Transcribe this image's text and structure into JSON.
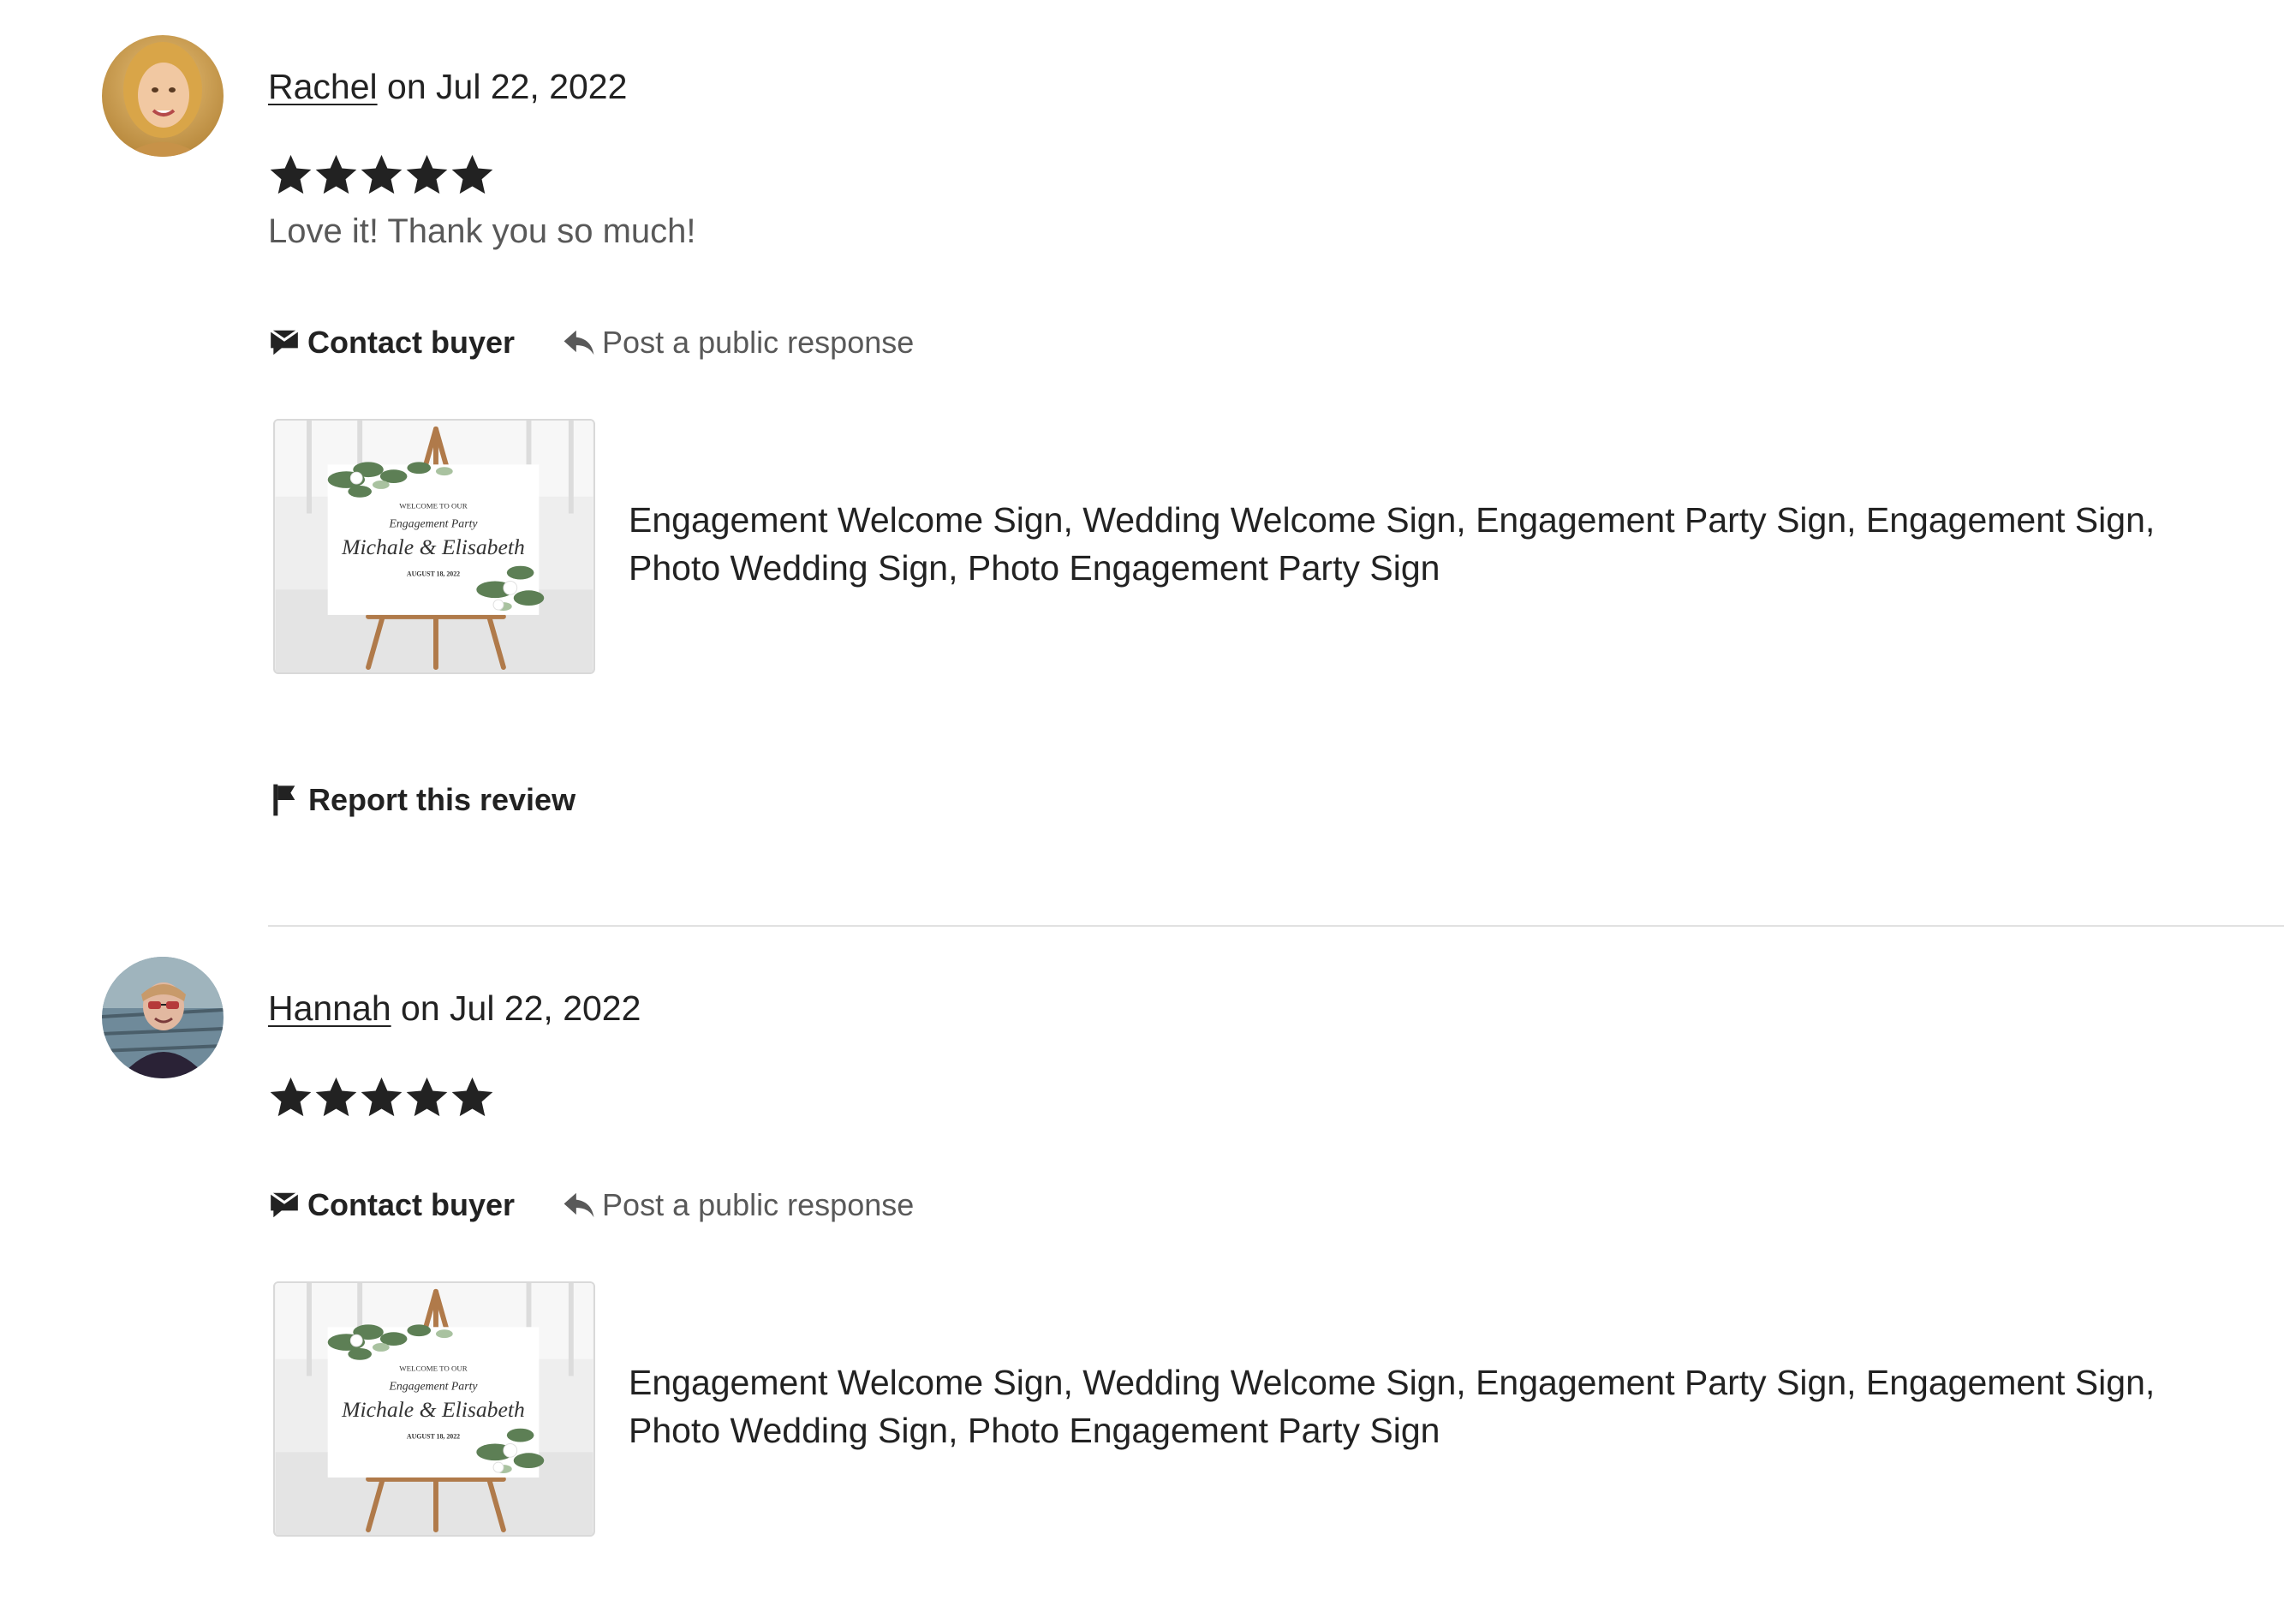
{
  "reviews": [
    {
      "reviewer": "Rachel",
      "date_text": " on Jul 22, 2022",
      "rating": 5,
      "text": "Love it! Thank you so much!",
      "contact_label": "Contact buyer",
      "respond_label": "Post a public response",
      "listing_title": "Engagement Welcome Sign, Wedding Welcome Sign, Engagement Party Sign, Engagement Sign, Photo Wedding Sign, Photo Engagement Party Sign",
      "report_label": "Report this review",
      "thumb": {
        "line1": "WELCOME TO OUR",
        "line2": "Engagement Party",
        "names": "Michale & Elisabeth",
        "date": "AUGUST 18, 2022"
      }
    },
    {
      "reviewer": "Hannah",
      "date_text": " on Jul 22, 2022",
      "rating": 5,
      "contact_label": "Contact buyer",
      "respond_label": "Post a public response",
      "listing_title": "Engagement Welcome Sign, Wedding Welcome Sign, Engagement Party Sign, Engagement Sign, Photo Wedding Sign, Photo Engagement Party Sign",
      "thumb": {
        "line1": "WELCOME TO OUR",
        "line2": "Engagement Party",
        "names": "Michale & Elisabeth",
        "date": "AUGUST 18, 2022"
      }
    }
  ],
  "icons": {
    "star": "star-icon",
    "contact": "message-icon",
    "respond": "reply-arrow-icon",
    "report": "flag-icon"
  },
  "colors": {
    "text": "#222222",
    "muted": "#595959",
    "divider": "#e1e1e1"
  }
}
